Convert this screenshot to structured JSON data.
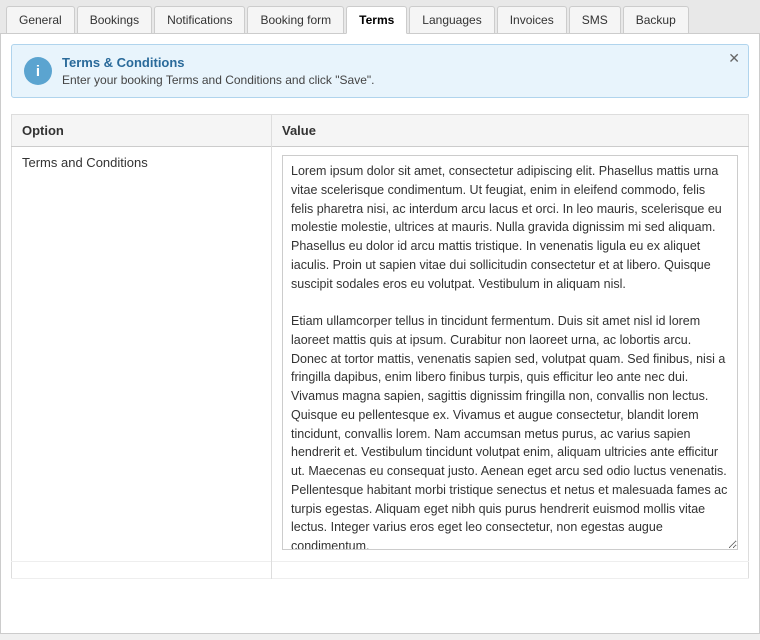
{
  "tabs": [
    {
      "id": "general",
      "label": "General",
      "active": false
    },
    {
      "id": "bookings",
      "label": "Bookings",
      "active": false
    },
    {
      "id": "notifications",
      "label": "Notifications",
      "active": false
    },
    {
      "id": "booking-form",
      "label": "Booking form",
      "active": false
    },
    {
      "id": "terms",
      "label": "Terms",
      "active": true
    },
    {
      "id": "languages",
      "label": "Languages",
      "active": false
    },
    {
      "id": "invoices",
      "label": "Invoices",
      "active": false
    },
    {
      "id": "sms",
      "label": "SMS",
      "active": false
    },
    {
      "id": "backup",
      "label": "Backup",
      "active": false
    }
  ],
  "banner": {
    "title": "Terms & Conditions",
    "description": "Enter your booking Terms and Conditions and click \"Save\".",
    "icon": "i"
  },
  "table": {
    "col1_header": "Option",
    "col2_header": "Value",
    "row_label": "Terms and Conditions",
    "terms_text": "Lorem ipsum dolor sit amet, consectetur adipiscing elit. Phasellus mattis urna vitae scelerisque condimentum. Ut feugiat, enim in eleifend commodo, felis felis pharetra nisi, ac interdum arcu lacus et orci. In leo mauris, scelerisque eu molestie molestie, ultrices at mauris. Nulla gravida dignissim mi sed aliquam. Phasellus eu dolor id arcu mattis tristique. In venenatis ligula eu ex aliquet iaculis. Proin ut sapien vitae dui sollicitudin consectetur et at libero. Quisque suscipit sodales eros eu volutpat. Vestibulum in aliquam nisl.\n\nEtiam ullamcorper tellus in tincidunt fermentum. Duis sit amet nisl id lorem laoreet mattis quis at ipsum. Curabitur non laoreet urna, ac lobortis arcu. Donec at tortor mattis, venenatis sapien sed, volutpat quam. Sed finibus, nisi a fringilla dapibus, enim libero finibus turpis, quis efficitur leo ante nec dui. Vivamus magna sapien, sagittis dignissim fringilla non, convallis non lectus. Quisque eu pellentesque ex. Vivamus et augue consectetur, blandit lorem tincidunt, convallis lorem. Nam accumsan metus purus, ac varius sapien hendrerit et. Vestibulum tincidunt volutpat enim, aliquam ultricies ante efficitur ut. Maecenas eu consequat justo. Aenean eget arcu sed odio luctus venenatis. Pellentesque habitant morbi tristique senectus et netus et malesuada fames ac turpis egestas. Aliquam eget nibh quis purus hendrerit euismod mollis vitae lectus. Integer varius eros eget leo consectetur, non egestas augue condimentum.\n\nMaecenas a nibh vel magna efficitur mattis in at lectus. Curabitur consectetur bibendum magna eget rhoncus. Sed"
  }
}
